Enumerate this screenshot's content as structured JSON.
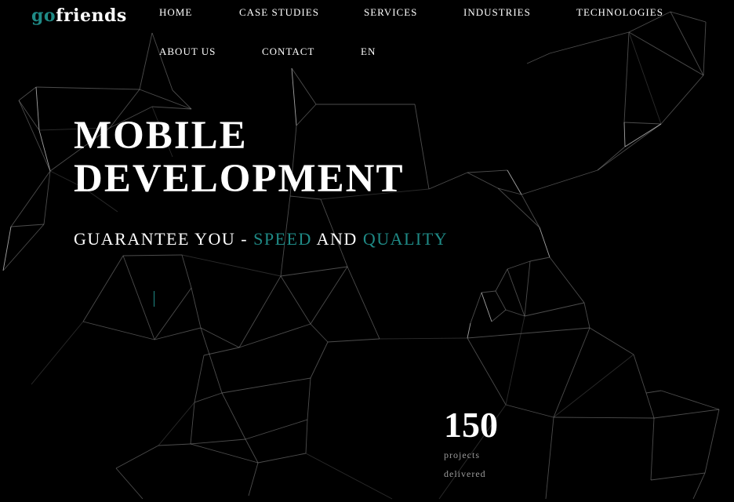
{
  "brand": {
    "logo_prefix": "go",
    "logo_suffix": "friends",
    "accent_color": "#1f8a86"
  },
  "nav": {
    "items": [
      {
        "label": "HOME"
      },
      {
        "label": "CASE STUDIES"
      },
      {
        "label": "SERVICES"
      },
      {
        "label": "INDUSTRIES"
      },
      {
        "label": "TECHNOLOGIES"
      },
      {
        "label": "ABOUT US"
      },
      {
        "label": "CONTACT"
      },
      {
        "label": "EN"
      }
    ]
  },
  "hero": {
    "title_line1": "MOBILE",
    "title_line2": "DEVELOPMENT",
    "tagline_prefix": "GUARANTEE YOU - ",
    "tagline_word1": "SPEED",
    "tagline_mid": " AND ",
    "tagline_word2": "QUALITY"
  },
  "stats": {
    "value": "150",
    "label_line1": "projects",
    "label_line2": "delivered"
  },
  "colors": {
    "background": "#000000",
    "text": "#ffffff",
    "accent": "#1f8a86",
    "muted": "#9a9a9a"
  }
}
